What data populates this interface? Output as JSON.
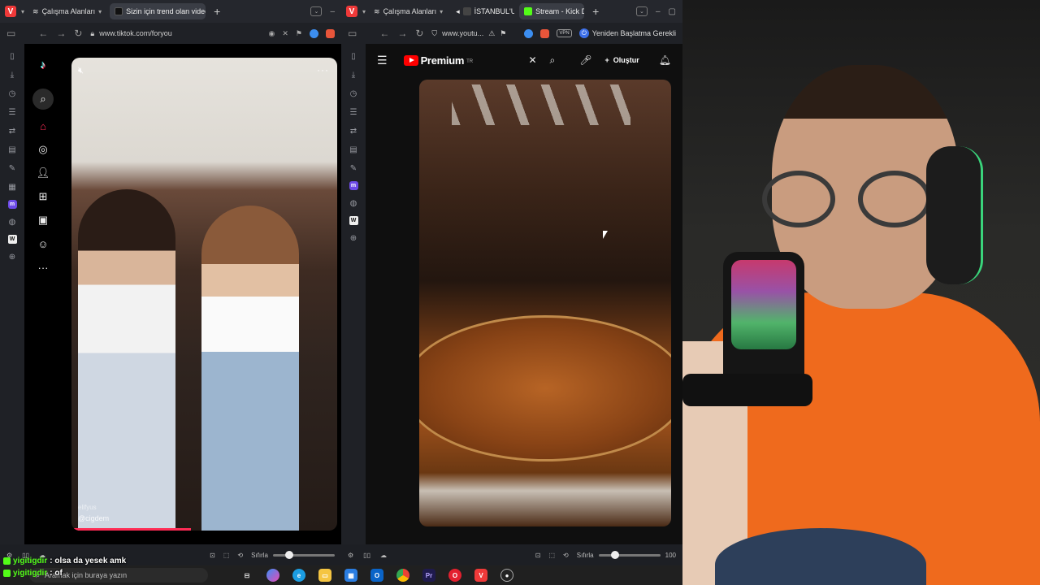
{
  "left_window": {
    "workspaces_label": "Çalışma Alanları",
    "tabs": [
      {
        "label": "Sizin için trend olan videolar",
        "color": "#111111"
      }
    ],
    "url": "www.tiktok.com/foryou",
    "zoom_label": "Sıfırla",
    "zoom_level": 0.2
  },
  "right_window": {
    "workspaces_label": "Çalışma Alanları",
    "tabs": [
      {
        "label": "İSTANBUL'UN",
        "color": "#444444"
      },
      {
        "label": "Stream - Kick Da",
        "color": "#53fc18"
      }
    ],
    "url": "www.youtu...",
    "restart_label": "Yeniden Başlatma Gerekli",
    "vpn_label": "VPN",
    "zoom_label": "Sıfırla",
    "zoom_percent": "100",
    "zoom_level": 0.2
  },
  "tiktok": {
    "username": "@cigdem",
    "username2": "elifyus",
    "progress": 0.45,
    "accent": "#fe2c55"
  },
  "youtube": {
    "brand": "Premium",
    "region": "TR",
    "create_label": "Oluştur",
    "accent": "#ff0000"
  },
  "taskbar": {
    "search_placeholder": "Aramak için buraya yazın"
  },
  "chat": [
    {
      "user": "yigitigdir",
      "message": ": olsa da yesek amk"
    },
    {
      "user": "yigitigdir",
      "message": ": of"
    }
  ]
}
